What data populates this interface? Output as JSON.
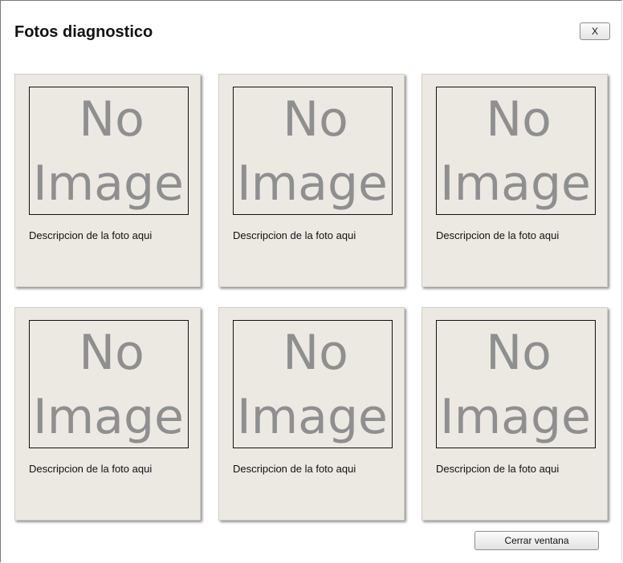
{
  "dialog": {
    "title": "Fotos diagnostico",
    "close_label": "X",
    "footer_button_label": "Cerrar ventana"
  },
  "photos": [
    {
      "placeholder_line1": "No",
      "placeholder_line2": "Image",
      "caption": "Descripcion de la foto aqui"
    },
    {
      "placeholder_line1": "No",
      "placeholder_line2": "Image",
      "caption": "Descripcion de la foto aqui"
    },
    {
      "placeholder_line1": "No",
      "placeholder_line2": "Image",
      "caption": "Descripcion de la foto aqui"
    },
    {
      "placeholder_line1": "No",
      "placeholder_line2": "Image",
      "caption": "Descripcion de la foto aqui"
    },
    {
      "placeholder_line1": "No",
      "placeholder_line2": "Image",
      "caption": "Descripcion de la foto aqui"
    },
    {
      "placeholder_line1": "No",
      "placeholder_line2": "Image",
      "caption": "Descripcion de la foto aqui"
    }
  ],
  "colors": {
    "card_background": "#ece9e3",
    "placeholder_text": "#8f8f8f"
  }
}
